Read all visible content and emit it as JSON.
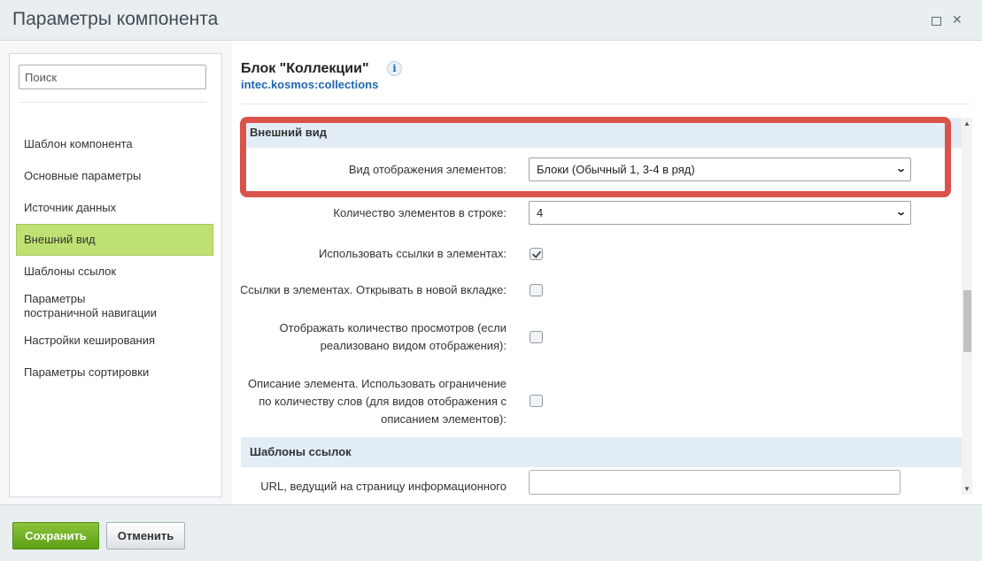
{
  "window": {
    "title": "Параметры компонента"
  },
  "sidebar": {
    "search_placeholder": "Поиск",
    "items": [
      {
        "label": "Шаблон компонента"
      },
      {
        "label": "Основные параметры"
      },
      {
        "label": "Источник данных"
      },
      {
        "label": "Внешний вид",
        "active": true
      },
      {
        "label": "Шаблоны ссылок"
      },
      {
        "label": "Параметры постраничной навигации"
      },
      {
        "label": "Настройки кеширования"
      },
      {
        "label": "Параметры сортировки"
      }
    ]
  },
  "component": {
    "title": "Блок \"Коллекции\"",
    "info_icon_glyph": "i",
    "code": "intec.kosmos:collections"
  },
  "sections": {
    "appearance": {
      "title": "Внешний вид",
      "rows": [
        {
          "label": "Вид отображения элементов:",
          "value": "Блоки (Обычный 1, 3-4 в ряд)"
        },
        {
          "label": "Количество элементов в строке:",
          "value": "4"
        },
        {
          "label": "Использовать ссылки в элементах:",
          "checked": true
        },
        {
          "label": "Ссылки в элементах. Открывать в новой вкладке:",
          "checked": false
        },
        {
          "label_lines": [
            "Отображать количество просмотров (если",
            "реализовано видом отображения):"
          ],
          "checked": false
        },
        {
          "label_lines": [
            "Описание элемента. Использовать ограничение",
            "по количеству слов (для видов отображения с",
            "описанием элементов):"
          ],
          "checked": false
        }
      ]
    },
    "link_templates": {
      "title": "Шаблоны ссылок",
      "partial_label": "URL, ведущий на страницу информационного"
    }
  },
  "footer": {
    "save_label": "Сохранить",
    "cancel_label": "Отменить"
  },
  "colors": {
    "active_item": "#bfe073",
    "section_header": "#e2edf6",
    "highlight_border": "#d9534b",
    "save_button": "#6aaa20",
    "link": "#2067b0"
  }
}
